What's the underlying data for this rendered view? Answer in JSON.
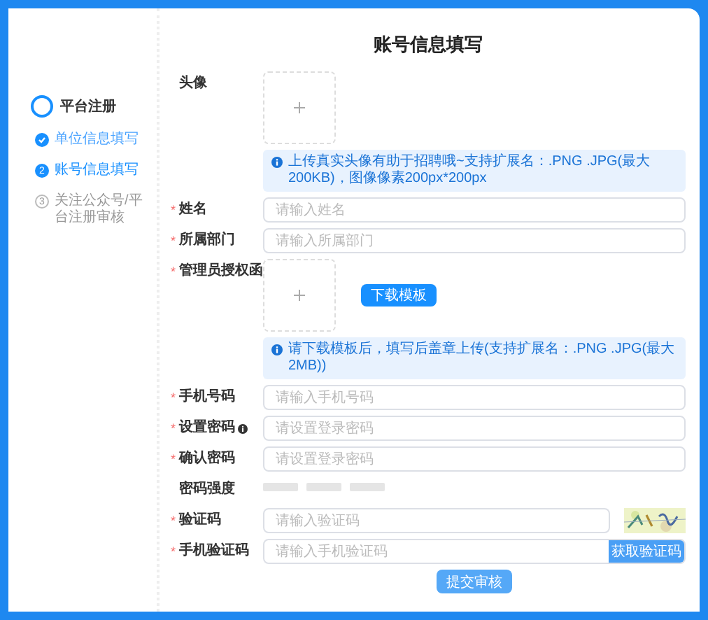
{
  "title": "账号信息填写",
  "sidebar": {
    "title": "平台注册",
    "steps": [
      {
        "label": "单位信息填写",
        "done": true,
        "selected": false
      },
      {
        "label": "账号信息填写",
        "done": false,
        "selected": true,
        "number": "2"
      },
      {
        "label": "关注公众号/平台注册审核",
        "done": false,
        "selected": false,
        "number": "3"
      }
    ]
  },
  "fields": [
    {
      "kind": "upload",
      "label": "头像",
      "hint": "上传真实头像有助于招聘哦~支持扩展名：.PNG .JPG(最大200KB)，图像像素200px*200px"
    },
    {
      "kind": "input",
      "label": "姓名",
      "required_mark": "*",
      "placeholder": "请输入姓名"
    },
    {
      "kind": "input",
      "label": "所属部门",
      "required_mark": "*",
      "placeholder": "请输入所属部门"
    },
    {
      "kind": "upload",
      "label": "管理员授权函",
      "required_mark": "*",
      "button": "下载模板",
      "hint": "请下载模板后，填写后盖章上传(支持扩展名：.PNG .JPG(最大2MB))"
    },
    {
      "kind": "input",
      "label": "手机号码",
      "required_mark": "*",
      "placeholder": "请输入手机号码"
    },
    {
      "kind": "input",
      "label": "设置密码",
      "required_mark": "*",
      "help": true,
      "placeholder": "请设置登录密码"
    },
    {
      "kind": "input",
      "label": "确认密码",
      "required_mark": "*",
      "placeholder": "请设置登录密码"
    },
    {
      "kind": "strength",
      "label": "密码强度"
    },
    {
      "kind": "captcha",
      "label": "验证码",
      "required_mark": "*",
      "placeholder": "请输入验证码"
    },
    {
      "kind": "sms",
      "label": "手机验证码",
      "required_mark": "*",
      "placeholder": "请输入手机验证码",
      "button": "获取验证码"
    }
  ],
  "submit": "提交审核"
}
